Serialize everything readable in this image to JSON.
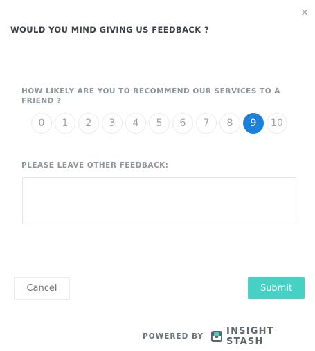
{
  "dialog": {
    "title": "WOULD YOU MIND GIVING US FEEDBACK ?",
    "close_glyph": "×"
  },
  "nps": {
    "question": "HOW LIKELY ARE YOU TO RECOMMEND OUR SERVICES TO A FRIEND ?",
    "scores": [
      "0",
      "1",
      "2",
      "3",
      "4",
      "5",
      "6",
      "7",
      "8",
      "9",
      "10"
    ],
    "selected_score": 9,
    "selected_color": "#1b7fdc"
  },
  "feedback": {
    "label": "PLEASE LEAVE OTHER FEEDBACK:",
    "value": "",
    "placeholder": ""
  },
  "actions": {
    "cancel_label": "Cancel",
    "submit_label": "Submit",
    "submit_color": "#46d1c4"
  },
  "footer": {
    "powered_by": "POWERED BY",
    "brand_name": "INSIGHT STASH",
    "brand_icon": "inbox-tray-icon"
  }
}
